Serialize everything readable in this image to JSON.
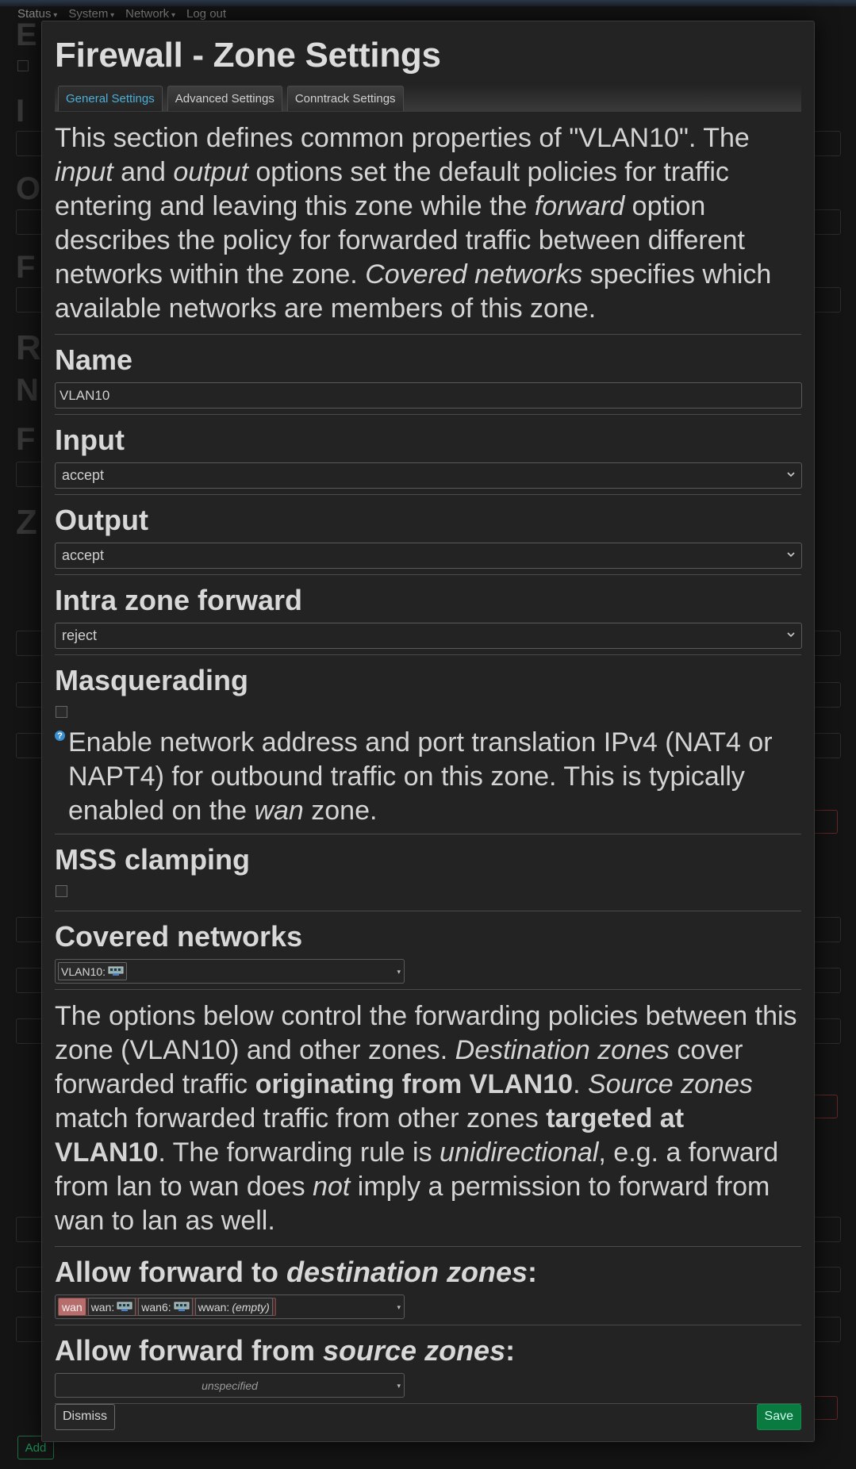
{
  "nav": {
    "items": [
      "Status",
      "System",
      "Network",
      "Log out"
    ]
  },
  "background": {
    "add_label": "Add"
  },
  "modal": {
    "title": "Firewall - Zone Settings",
    "tabs": [
      {
        "label": "General Settings",
        "active": true
      },
      {
        "label": "Advanced Settings",
        "active": false
      },
      {
        "label": "Conntrack Settings",
        "active": false
      }
    ],
    "intro": {
      "p1": "This section defines common properties of \"VLAN10\". The ",
      "e1": "input",
      "p2": " and ",
      "e2": "output",
      "p3": " options set the default policies for traffic entering and leaving this zone while the ",
      "e3": "forward",
      "p4": " option describes the policy for forwarded traffic between different networks within the zone. ",
      "e4": "Covered networks",
      "p5": " specifies which available networks are members of this zone."
    },
    "name": {
      "label": "Name",
      "value": "VLAN10"
    },
    "input": {
      "label": "Input",
      "value": "accept"
    },
    "output": {
      "label": "Output",
      "value": "accept"
    },
    "intra": {
      "label": "Intra zone forward",
      "value": "reject"
    },
    "masq": {
      "label": "Masquerading",
      "checked": false,
      "help_p1": "Enable network address and port translation IPv4 (NAT4 or NAPT4) for outbound traffic on this zone. This is typically enabled on the ",
      "help_em": "wan",
      "help_p2": " zone."
    },
    "mss": {
      "label": "MSS clamping",
      "checked": false
    },
    "covered": {
      "label": "Covered networks",
      "chip": "VLAN10:"
    },
    "forwarding_desc": {
      "p1": "The options below control the forwarding policies between this zone (VLAN10) and other zones. ",
      "e1": "Destination zones",
      "p2": " cover forwarded traffic ",
      "b1": "originating from VLAN10",
      "p3": ". ",
      "e2": "Source zones",
      "p4": " match forwarded traffic from other zones ",
      "b2": "targeted at VLAN10",
      "p5": ". The forwarding rule is ",
      "e3": "unidirectional",
      "p6": ", e.g. a forward from lan to wan does ",
      "e4": "not",
      "p7": " imply a permission to forward from wan to lan as well."
    },
    "dest": {
      "label_pre": "Allow forward to ",
      "label_em": "destination zones",
      "label_post": ":",
      "zone": "wan",
      "nets": [
        "wan:",
        "wan6:",
        "wwan:"
      ],
      "empty": "(empty)"
    },
    "src": {
      "label_pre": "Allow forward from ",
      "label_em": "source zones",
      "label_post": ":",
      "placeholder": "unspecified"
    },
    "dismiss": "Dismiss",
    "save": "Save"
  },
  "colors": {
    "accent": "#4ab0d9",
    "zone_wan": "#b86d6d",
    "save": "#0b7a40"
  }
}
